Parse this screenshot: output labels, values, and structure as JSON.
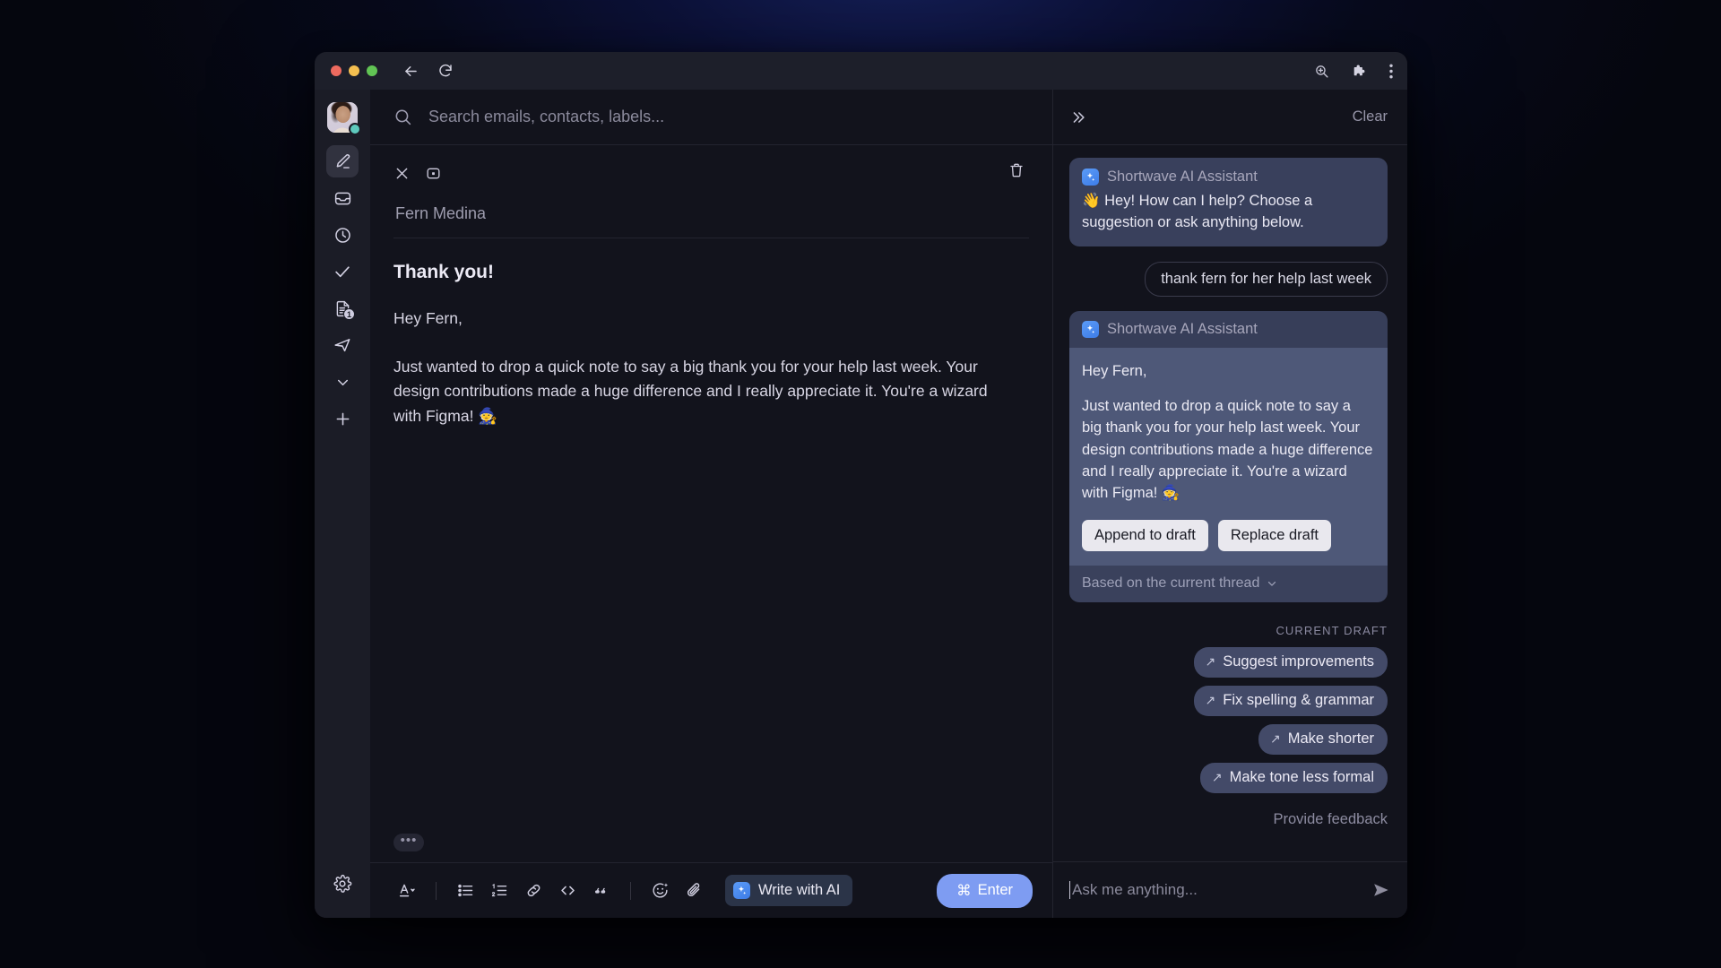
{
  "browser": {
    "back_icon": "back-arrow-icon",
    "reload_icon": "reload-icon",
    "zoom_icon": "zoom-in-icon",
    "extensions_icon": "puzzle-piece-icon",
    "menu_icon": "three-dot-menu-icon"
  },
  "rail": {
    "avatar_name": "user-avatar",
    "status": "online",
    "items": [
      {
        "icon": "compose-pencil-icon",
        "name": "compose",
        "active": true,
        "badge": ""
      },
      {
        "icon": "inbox-icon",
        "name": "inbox",
        "active": false,
        "badge": ""
      },
      {
        "icon": "clock-snoozed-icon",
        "name": "snoozed",
        "active": false,
        "badge": ""
      },
      {
        "icon": "checkmark-done-icon",
        "name": "done",
        "active": false,
        "badge": ""
      },
      {
        "icon": "drafts-document-icon",
        "name": "drafts",
        "active": false,
        "badge": "1"
      },
      {
        "icon": "paper-plane-sent-icon",
        "name": "sent",
        "active": false,
        "badge": ""
      },
      {
        "icon": "chevron-down-icon",
        "name": "more",
        "active": false,
        "badge": ""
      },
      {
        "icon": "plus-icon",
        "name": "add",
        "active": false,
        "badge": ""
      }
    ],
    "settings_icon": "gear-settings-icon"
  },
  "search": {
    "placeholder": "Search emails, contacts, labels...",
    "value": "",
    "icon": "search-icon"
  },
  "compose": {
    "close_icon": "close-x-icon",
    "minimize_icon": "minimize-window-icon",
    "delete_icon": "trash-delete-icon",
    "recipient": "Fern Medina",
    "subject": "Thank you!",
    "paragraphs": [
      "Hey Fern,",
      "Just wanted to drop a quick note to say a big thank you for your help last week. Your design contributions made a huge difference and I really appreciate it. You're a wizard with Figma! 🧙"
    ],
    "more_options": "•••"
  },
  "toolbar": {
    "items": [
      {
        "name": "text-format-icon",
        "label": "A"
      },
      {
        "name": "bullet-list-icon",
        "label": ""
      },
      {
        "name": "numbered-list-icon",
        "label": ""
      },
      {
        "name": "link-icon",
        "label": ""
      },
      {
        "name": "code-icon",
        "label": ""
      },
      {
        "name": "quote-icon",
        "label": ""
      },
      {
        "name": "emoji-icon",
        "label": ""
      },
      {
        "name": "attachment-paperclip-icon",
        "label": ""
      }
    ],
    "write_with_ai": "Write with AI",
    "send_label": "Enter",
    "send_modifier": "⌘"
  },
  "panel": {
    "collapse_icon": "double-chevron-right-icon",
    "clear_label": "Clear",
    "assistant_name": "Shortwave AI Assistant",
    "assistant_icon": "ai-sparkle-icon",
    "greeting": "👋 Hey! How can I help? Choose a suggestion or ask anything below.",
    "user_message": "thank fern for her help last week",
    "draft_paragraphs": [
      "Hey Fern,",
      "Just wanted to drop a quick note to say a big thank you for your help last week. Your design contributions made a huge difference and I really appreciate it. You're a wizard with Figma! 🧙"
    ],
    "append_label": "Append to draft",
    "replace_label": "Replace draft",
    "context_label": "Based on the current thread",
    "context_icon": "chevron-down-icon",
    "draft_section_label": "CURRENT DRAFT",
    "suggestions": [
      "Suggest improvements",
      "Fix spelling & grammar",
      "Make shorter",
      "Make tone less formal"
    ],
    "suggestion_arrow": "↗",
    "feedback_label": "Provide feedback",
    "ask_placeholder": "Ask me anything...",
    "ask_value": "",
    "send_icon": "send-arrow-icon"
  },
  "colors": {
    "accent_blue": "#7e9cf2",
    "ai_card_body": "#4e5878",
    "ai_card_head": "#373e59",
    "chip": "#434a68",
    "status_online": "#5ec9bd"
  }
}
